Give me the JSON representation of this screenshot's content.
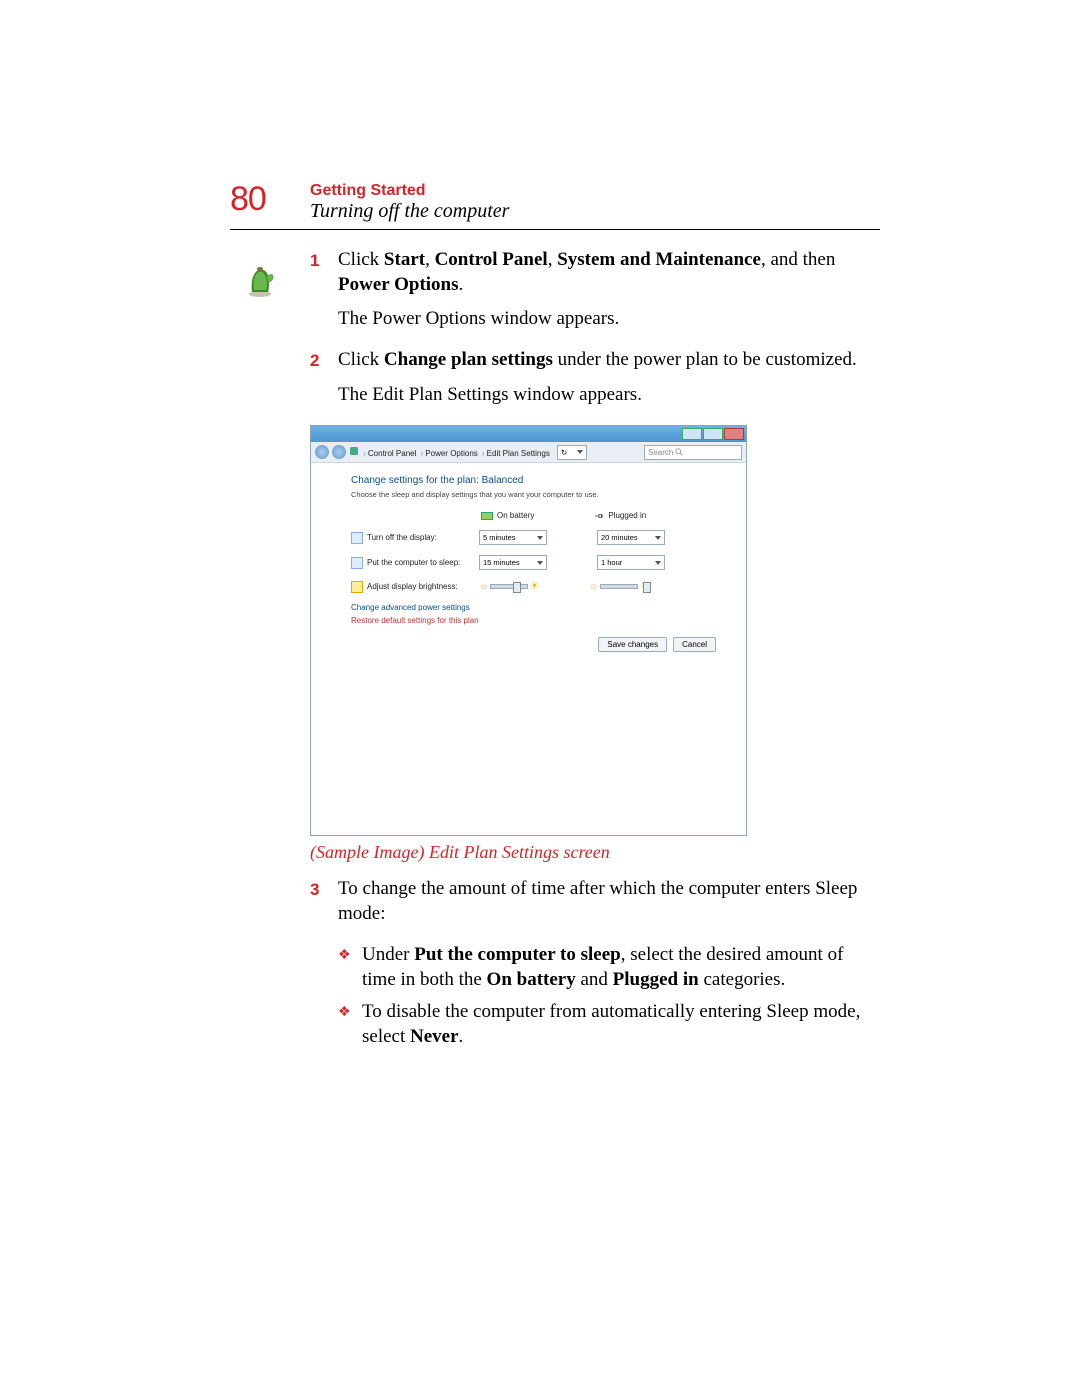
{
  "page_number": "80",
  "chapter_title": "Getting Started",
  "section_title": "Turning off the computer",
  "steps": {
    "s1_num": "1",
    "s1_a": "Click ",
    "s1_b_start": "Start",
    "s1_b_sep1": ", ",
    "s1_b_cp": "Control Panel",
    "s1_b_sep2": ", ",
    "s1_b_sm": "System and Maintenance",
    "s1_b_sep3": ", and then ",
    "s1_b_po": "Power Options",
    "s1_b_end": ".",
    "s1_p2": "The Power Options window appears.",
    "s2_num": "2",
    "s2_a": "Click ",
    "s2_b": "Change plan settings",
    "s2_c": " under the power plan to be customized.",
    "s2_p2": "The Edit Plan Settings window appears.",
    "s3_num": "3",
    "s3_text": "To change the amount of time after which the computer enters Sleep mode:"
  },
  "caption": "(Sample Image) Edit Plan Settings screen",
  "bullets": {
    "b1_a": "Under ",
    "b1_b": "Put the computer to sleep",
    "b1_c": ", select the desired amount of time in both the ",
    "b1_d": "On battery",
    "b1_e": " and ",
    "b1_f": "Plugged in",
    "b1_g": " categories.",
    "b2_a": "To disable the computer from automatically entering Sleep mode, select ",
    "b2_b": "Never",
    "b2_c": "."
  },
  "screenshot": {
    "breadcrumb": {
      "p1": "Control Panel",
      "p2": "Power Options",
      "p3": "Edit Plan Settings"
    },
    "search_placeholder": "Search",
    "heading": "Change settings for the plan: Balanced",
    "subheading": "Choose the sleep and display settings that you want your computer to use.",
    "col_battery": "On battery",
    "col_plugged": "Plugged in",
    "row1_label": "Turn off the display:",
    "row1_batt": "5 minutes",
    "row1_plug": "20 minutes",
    "row2_label": "Put the computer to sleep:",
    "row2_batt": "15 minutes",
    "row2_plug": "1 hour",
    "row3_label": "Adjust display brightness:",
    "link1": "Change advanced power settings",
    "link2": "Restore default settings for this plan",
    "btn_save": "Save changes",
    "btn_cancel": "Cancel"
  }
}
